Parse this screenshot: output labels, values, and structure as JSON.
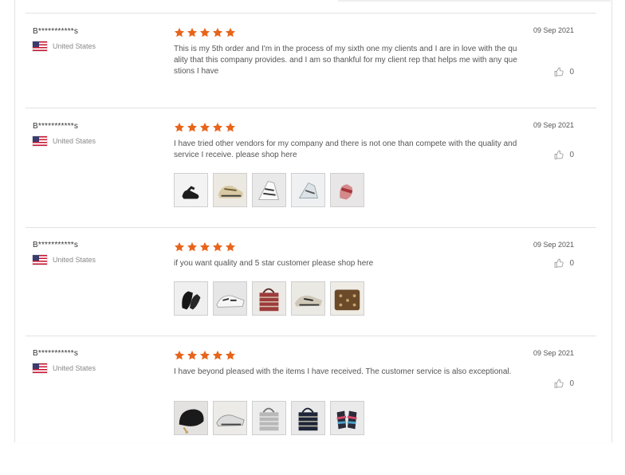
{
  "reviews": [
    {
      "reviewer": "B***********s",
      "country": "United States",
      "rating": 5,
      "text": "This is my 5th order and I'm in the process of my sixth one my clients and I are in love with the quality that this company provides. and I am so thankful for my client rep that helps me with any questions I have",
      "date": "09 Sep 2021",
      "likes": "0",
      "photos": []
    },
    {
      "reviewer": "B***********s",
      "country": "United States",
      "rating": 5,
      "text": "I have tried other vendors for my company and there is not one than compete with the quality and service I receive. please shop here",
      "date": "09 Sep 2021",
      "likes": "0",
      "photos": [
        "black-sneaker-photo",
        "gold-sneaker-photo",
        "striped-sneaker-photo",
        "silver-sneaker-photo",
        "pink-slide-photo"
      ]
    },
    {
      "reviewer": "B***********s",
      "country": "United States",
      "rating": 5,
      "text": "if you want quality and 5 star customer please shop here",
      "date": "09 Sep 2021",
      "likes": "0",
      "photos": [
        "black-slide-photo",
        "striped-sneaker-photo",
        "red-tote-bag-photo",
        "metallic-sneaker-photo",
        "monogram-bag-photo"
      ]
    },
    {
      "reviewer": "B***********s",
      "country": "United States",
      "rating": 5,
      "text": "I have beyond pleased with the items I have received. The customer service is also exceptional.",
      "date": "09 Sep 2021",
      "likes": "0",
      "photos": [
        "black-saddle-bag-photo",
        "silver-sneaker-photo",
        "grey-tote-bag-photo",
        "navy-tote-bag-photo",
        "multicolor-sandal-photo"
      ]
    }
  ],
  "colors": {
    "star": "#e8641b",
    "divider": "#e2e2e2"
  }
}
